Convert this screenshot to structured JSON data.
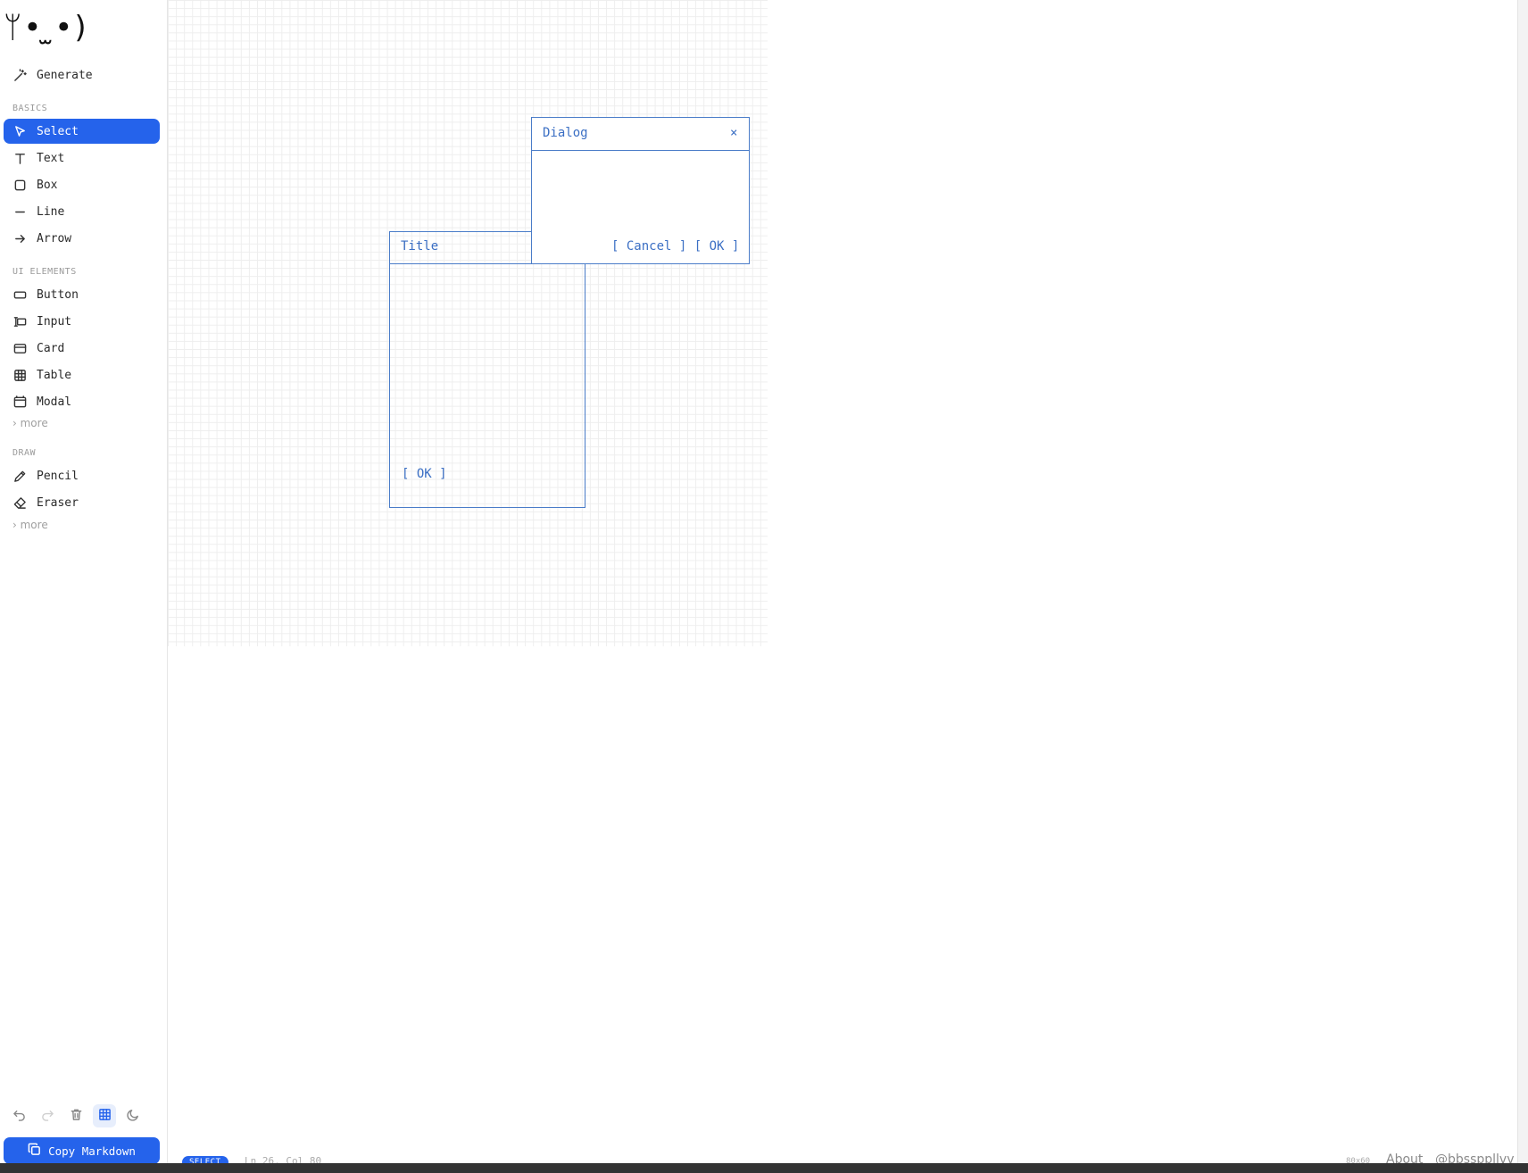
{
  "app": {
    "logo": "ᛘ•  ̫•)"
  },
  "sidebar": {
    "generate": {
      "label": "Generate",
      "icon": "magic-wand-icon"
    },
    "sections": {
      "basics": "BASICS",
      "ui_elements": "UI ELEMENTS",
      "draw": "DRAW"
    },
    "basics": [
      {
        "label": "Select",
        "icon": "cursor-icon",
        "active": true
      },
      {
        "label": "Text",
        "icon": "text-icon"
      },
      {
        "label": "Box",
        "icon": "box-icon"
      },
      {
        "label": "Line",
        "icon": "line-icon"
      },
      {
        "label": "Arrow",
        "icon": "arrow-icon"
      }
    ],
    "ui_elements": [
      {
        "label": "Button",
        "icon": "button-icon"
      },
      {
        "label": "Input",
        "icon": "input-icon"
      },
      {
        "label": "Card",
        "icon": "card-icon"
      },
      {
        "label": "Table",
        "icon": "table-icon"
      },
      {
        "label": "Modal",
        "icon": "modal-icon"
      }
    ],
    "draw": [
      {
        "label": "Pencil",
        "icon": "pencil-icon"
      },
      {
        "label": "Eraser",
        "icon": "eraser-icon"
      }
    ],
    "more_label": "› more",
    "copy_button": "Copy Markdown",
    "accent": "#2563eb"
  },
  "canvas": {
    "dialog": {
      "title": "Dialog",
      "close": "×",
      "buttons": "[ Cancel ] [ OK ]"
    },
    "card": {
      "title": "Title",
      "button": "[ OK ]"
    },
    "stroke_color": "#4a7cc8"
  },
  "status": {
    "mode": "SELECT",
    "position": "Ln 26, Col 80",
    "ratio": "80x60",
    "about": "About",
    "handle": "@bbssppllvv"
  }
}
